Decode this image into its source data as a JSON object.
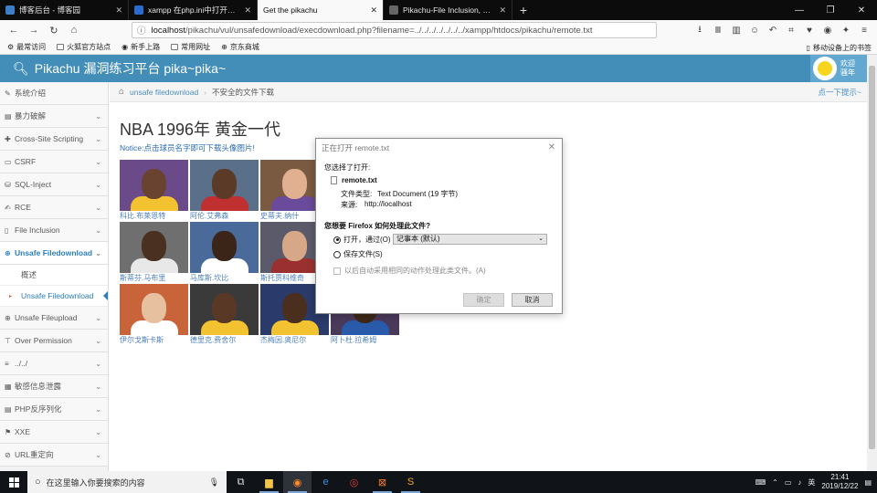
{
  "tabs": [
    {
      "title": "博客后台 - 博客园",
      "fav_color": "#3c7fc8"
    },
    {
      "title": "xampp 在php.ini中打开了两…",
      "fav_color": "#2a6bd0"
    },
    {
      "title": "Get the pikachu",
      "fav_color": "#f9f9fa"
    },
    {
      "title": "Pikachu-File Inclusion, Uns…",
      "fav_color": "#888888"
    }
  ],
  "url": {
    "host": "localhost",
    "path": "/pikachu/vul/unsafedownload/execdownload.php?filename=../../../../../../../xampp/htdocs/pikachu/remote.txt"
  },
  "bookmarks": [
    "最常访问",
    "火狐官方站点",
    "新手上路",
    "常用网址",
    "京东商城"
  ],
  "bookmarks_right": "移动设备上的书签",
  "site": {
    "title": "Pikachu 漏洞练习平台 pika~pika~",
    "welcome": "欢迎",
    "user": "骚年"
  },
  "sidebar": [
    {
      "icon": "✎",
      "label": "系统介绍",
      "open": false
    },
    {
      "icon": "▤",
      "label": "暴力破解",
      "open": false
    },
    {
      "icon": "✚",
      "label": "Cross-Site Scripting",
      "open": false
    },
    {
      "icon": "▭",
      "label": "CSRF",
      "open": false
    },
    {
      "icon": "⛁",
      "label": "SQL-Inject",
      "open": false
    },
    {
      "icon": "✍",
      "label": "RCE",
      "open": false
    },
    {
      "icon": "▯",
      "label": "File Inclusion",
      "open": false
    },
    {
      "icon": "⊕",
      "label": "Unsafe Filedownload",
      "open": true
    },
    {
      "icon": "⊕",
      "label": "Unsafe Fileupload",
      "open": false
    },
    {
      "icon": "⊤",
      "label": "Over Permission",
      "open": false
    },
    {
      "icon": "≡",
      "label": "../../",
      "open": false
    },
    {
      "icon": "▦",
      "label": "敏感信息泄露",
      "open": false
    },
    {
      "icon": "▤",
      "label": "PHP反序列化",
      "open": false
    },
    {
      "icon": "⚑",
      "label": "XXE",
      "open": false
    },
    {
      "icon": "⊘",
      "label": "URL重定向",
      "open": false
    }
  ],
  "subitems": [
    "概述",
    "Unsafe Filedownload"
  ],
  "breadcrumb": {
    "link": "unsafe filedownload",
    "current": "不安全的文件下载",
    "hint": "点一下提示~"
  },
  "page": {
    "title": "NBA 1996年 黄金一代",
    "notice": "Notice:点击球员名字即可下载头像图片!"
  },
  "players": [
    {
      "name": "科比.布莱恩特",
      "bg": "#6b4a8a",
      "skin": "#6a4330",
      "shirt": "#f2c230"
    },
    {
      "name": "阿伦.艾弗森",
      "bg": "#5a6f8a",
      "skin": "#5c3a28",
      "shirt": "#c03030"
    },
    {
      "name": "史蒂夫.纳什",
      "bg": "#7a5a40",
      "skin": "#e0b090",
      "shirt": "#6a4a9a"
    },
    {
      "name": "斯蒂芬.马布里",
      "bg": "#6f6f6f",
      "skin": "#4a3020",
      "shirt": "#e8e8e8"
    },
    {
      "name": "马库斯.坎比",
      "bg": "#4a6a9a",
      "skin": "#3a2518",
      "shirt": "#ffffff"
    },
    {
      "name": "斯托贾科维奇",
      "bg": "#5a5a6a",
      "skin": "#d6a888",
      "shirt": "#9a3030"
    },
    {
      "name": "伊尔戈斯卡斯",
      "bg": "#c9643a",
      "skin": "#e7c0a0",
      "shirt": "#ffffff"
    },
    {
      "name": "德里克.费舍尔",
      "bg": "#3a3a3a",
      "skin": "#5a3826",
      "shirt": "#f2c230"
    },
    {
      "name": "杰梅因.奥尼尔",
      "bg": "#2a3a6a",
      "skin": "#4a2e1e",
      "shirt": "#f2c230"
    },
    {
      "name": "阿卜杜.拉希姆",
      "bg": "#4a3a5a",
      "skin": "#3e2818",
      "shirt": "#2a5aaa"
    }
  ],
  "dialog": {
    "title": "正在打开 remote.txt",
    "you_chose": "您选择了打开:",
    "filename": "remote.txt",
    "type_label": "文件类型:",
    "type_value": "Text Document (19 字节)",
    "source_label": "来源:",
    "source_value": "http://localhost",
    "question": "您想要 Firefox 如何处理此文件?",
    "open_with": "打开，通过(O)",
    "app": "记事本 (默认)",
    "save": "保存文件(S)",
    "remember": "以后自动采用相同的动作处理此类文件。(A)",
    "ok": "确定",
    "cancel": "取消"
  },
  "taskbar": {
    "search": "在这里输入你要搜索的内容",
    "time": "21:41",
    "date": "2019/12/22"
  }
}
